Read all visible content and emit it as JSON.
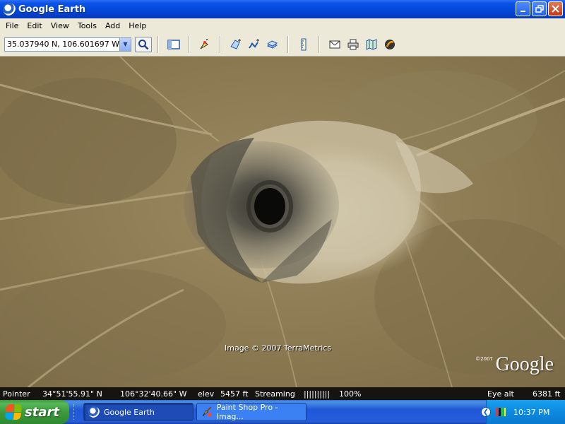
{
  "window": {
    "title": "Google Earth",
    "controls": [
      "minimize",
      "restore",
      "close"
    ]
  },
  "menu": [
    "File",
    "Edit",
    "View",
    "Tools",
    "Add",
    "Help"
  ],
  "toolbar": {
    "coordinates_value": "35.037940 N, 106.601697 W",
    "icons": [
      "search-icon",
      "sidebar-icon",
      "placemark-icon",
      "polygon-icon",
      "path-icon",
      "overlay-icon",
      "ruler-icon",
      "email-icon",
      "print-icon",
      "maps-icon",
      "globe-icon"
    ]
  },
  "map": {
    "attribution": "Image © 2007 TerraMetrics",
    "logo_year": "©2007",
    "logo_text": "Google"
  },
  "status": {
    "pointer_label": "Pointer",
    "latitude": "34°51'55.91\" N",
    "longitude": "106°32'40.66\" W",
    "elev_label": "elev",
    "elev_value": "5457 ft",
    "streaming_label": "Streaming",
    "streaming_bar": "||||||||||",
    "streaming_percent": "100%",
    "eye_alt_label": "Eye alt",
    "eye_alt_value": "6381 ft"
  },
  "taskbar": {
    "start_label": "start",
    "tasks": [
      {
        "label": "Google Earth",
        "active": true
      },
      {
        "label": "Paint Shop Pro - Imag...",
        "active": false
      }
    ],
    "clock": "10:37 PM"
  },
  "colors": {
    "titlebar": "#0a52e6",
    "menubar": "#ece9d8",
    "taskbar": "#245edb",
    "start_button": "#3c9a3c",
    "tray": "#0c8ae0"
  }
}
